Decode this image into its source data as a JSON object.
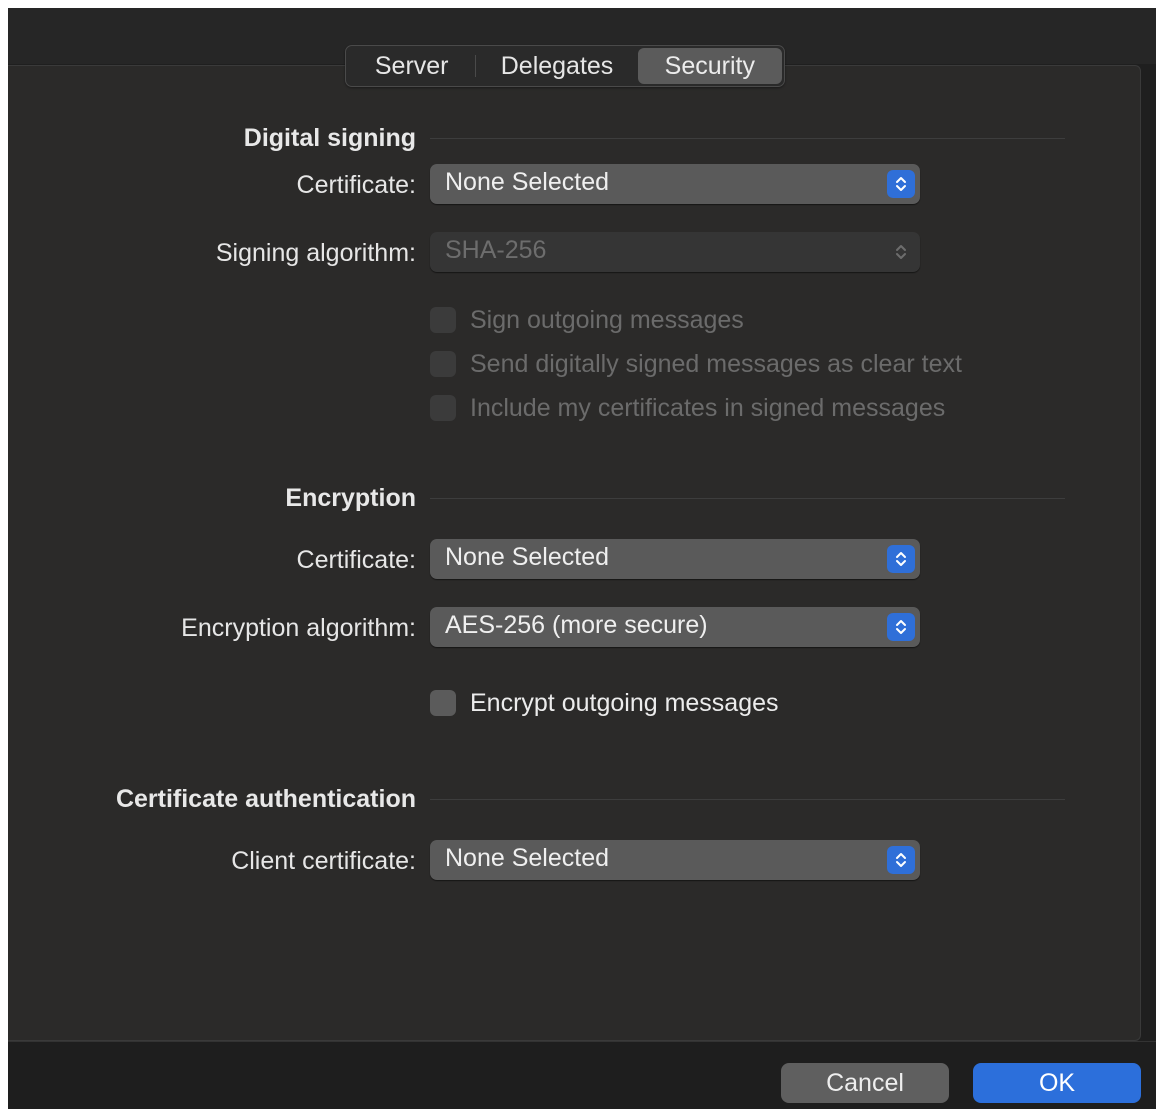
{
  "tabs": [
    {
      "label": "Server"
    },
    {
      "label": "Delegates"
    },
    {
      "label": "Security",
      "selected": true
    }
  ],
  "digital_signing": {
    "title": "Digital signing",
    "certificate_label": "Certificate:",
    "certificate_value": "None Selected",
    "algorithm_label": "Signing algorithm:",
    "algorithm_value": "SHA-256",
    "options": [
      {
        "label": "Sign outgoing messages",
        "checked": false,
        "enabled": false
      },
      {
        "label": "Send digitally signed messages as clear text",
        "checked": false,
        "enabled": false
      },
      {
        "label": "Include my certificates in signed messages",
        "checked": false,
        "enabled": false
      }
    ]
  },
  "encryption": {
    "title": "Encryption",
    "certificate_label": "Certificate:",
    "certificate_value": "None Selected",
    "algorithm_label": "Encryption algorithm:",
    "algorithm_value": "AES-256 (more secure)",
    "options": [
      {
        "label": "Encrypt outgoing messages",
        "checked": false,
        "enabled": true
      }
    ]
  },
  "certificate_authentication": {
    "title": "Certificate authentication",
    "client_certificate_label": "Client certificate:",
    "client_certificate_value": "None Selected"
  },
  "buttons": {
    "cancel": "Cancel",
    "ok": "OK"
  },
  "colors": {
    "accent": "#2c6fdb",
    "background": "#2b2a29",
    "control": "#5a5a5a"
  }
}
